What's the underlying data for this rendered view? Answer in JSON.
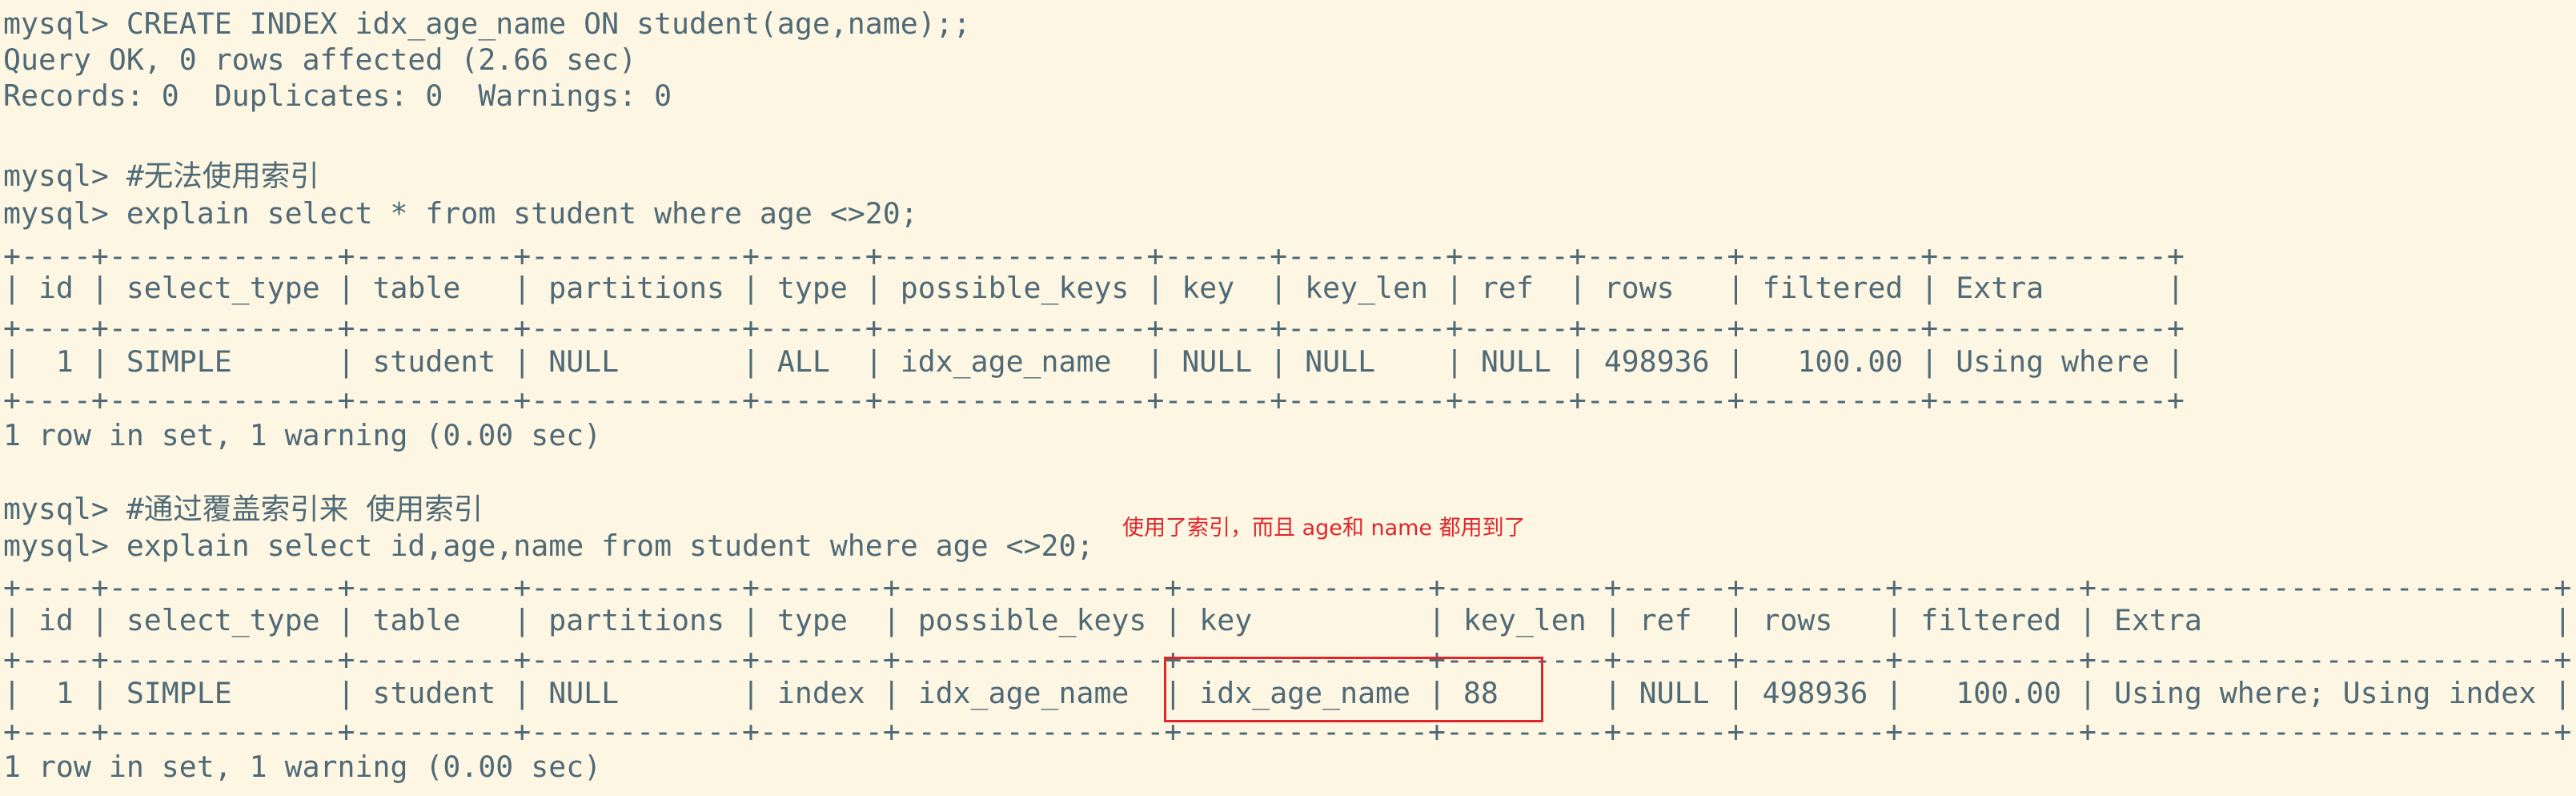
{
  "terminal": {
    "lines": [
      "mysql> CREATE INDEX idx_age_name ON student(age,name);;",
      "Query OK, 0 rows affected (2.66 sec)",
      "Records: 0  Duplicates: 0  Warnings: 0",
      "",
      "mysql> #无法使用索引",
      "mysql> explain select * from student where age <>20;",
      "+----+-------------+---------+------------+------+---------------+------+---------+------+--------+----------+-------------+",
      "| id | select_type | table   | partitions | type | possible_keys | key  | key_len | ref  | rows   | filtered | Extra       |",
      "+----+-------------+---------+------------+------+---------------+------+---------+------+--------+----------+-------------+",
      "|  1 | SIMPLE      | student | NULL       | ALL  | idx_age_name  | NULL | NULL    | NULL | 498936 |   100.00 | Using where |",
      "+----+-------------+---------+------------+------+---------------+------+---------+------+--------+----------+-------------+",
      "1 row in set, 1 warning (0.00 sec)",
      "",
      "mysql> #通过覆盖索引来 使用索引",
      "mysql> explain select id,age,name from student where age <>20;",
      "+----+-------------+---------+------------+-------+---------------+--------------+---------+------+--------+----------+--------------------------+",
      "| id | select_type | table   | partitions | type  | possible_keys | key          | key_len | ref  | rows   | filtered | Extra                    |",
      "+----+-------------+---------+------------+-------+---------------+--------------+---------+------+--------+----------+--------------------------+",
      "|  1 | SIMPLE      | student | NULL       | index | idx_age_name  | idx_age_name | 88      | NULL | 498936 |   100.00 | Using where; Using index |",
      "+----+-------------+---------+------------+-------+---------------+--------------+---------+------+--------+----------+--------------------------+",
      "1 row in set, 1 warning (0.00 sec)"
    ]
  },
  "annotation": {
    "note": "使用了索引，而且 age和 name 都用到了"
  },
  "colors": {
    "background": "#fdf6e3",
    "text": "#4f6a76",
    "annotation": "#e0252b"
  }
}
